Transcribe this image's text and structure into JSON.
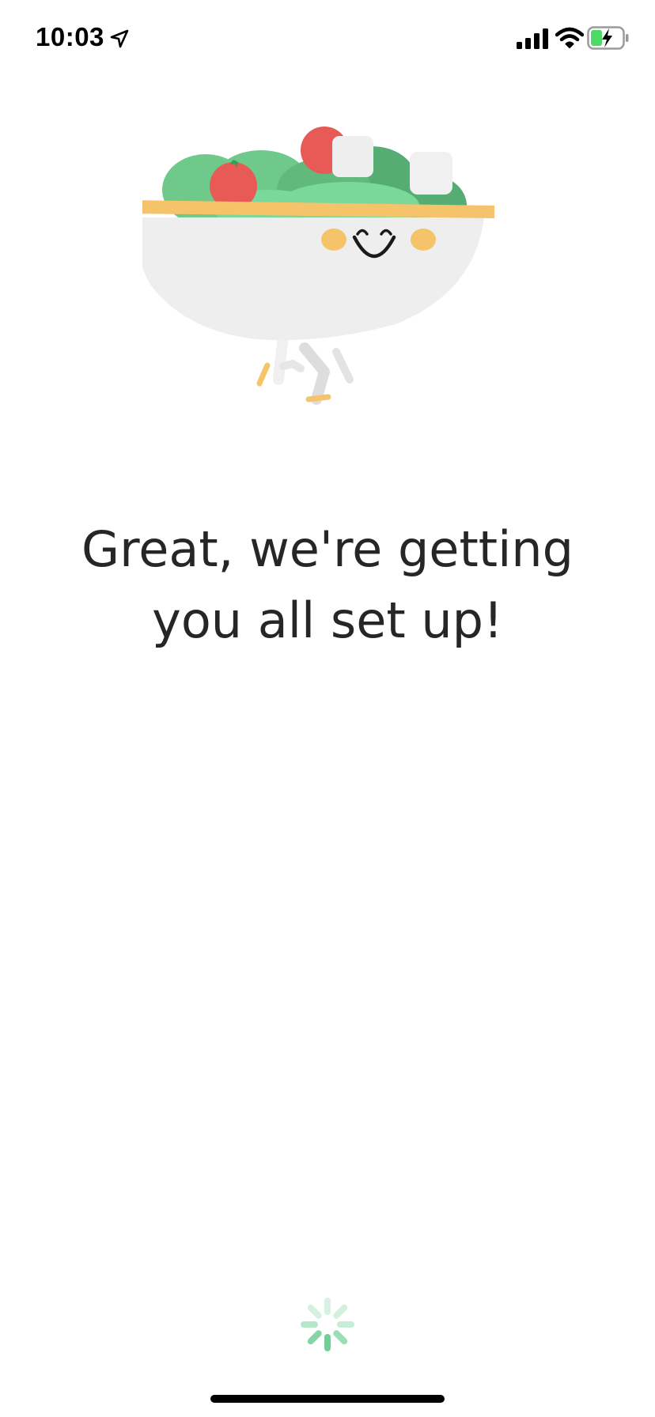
{
  "status_bar": {
    "time": "10:03",
    "icons": [
      "location-arrow-icon",
      "cellular-signal-icon",
      "wifi-icon",
      "battery-charging-icon"
    ]
  },
  "illustration": {
    "name": "salad-bowl-mascot"
  },
  "main": {
    "headline": "Great, we're getting you all set up!"
  },
  "loading": {
    "icon": "loading-spinner-icon"
  },
  "colors": {
    "accent_green": "#6fcf97",
    "text": "#262626",
    "bowl": "#eeeeee",
    "rim": "#f5c46a",
    "tomato": "#e85a55"
  }
}
